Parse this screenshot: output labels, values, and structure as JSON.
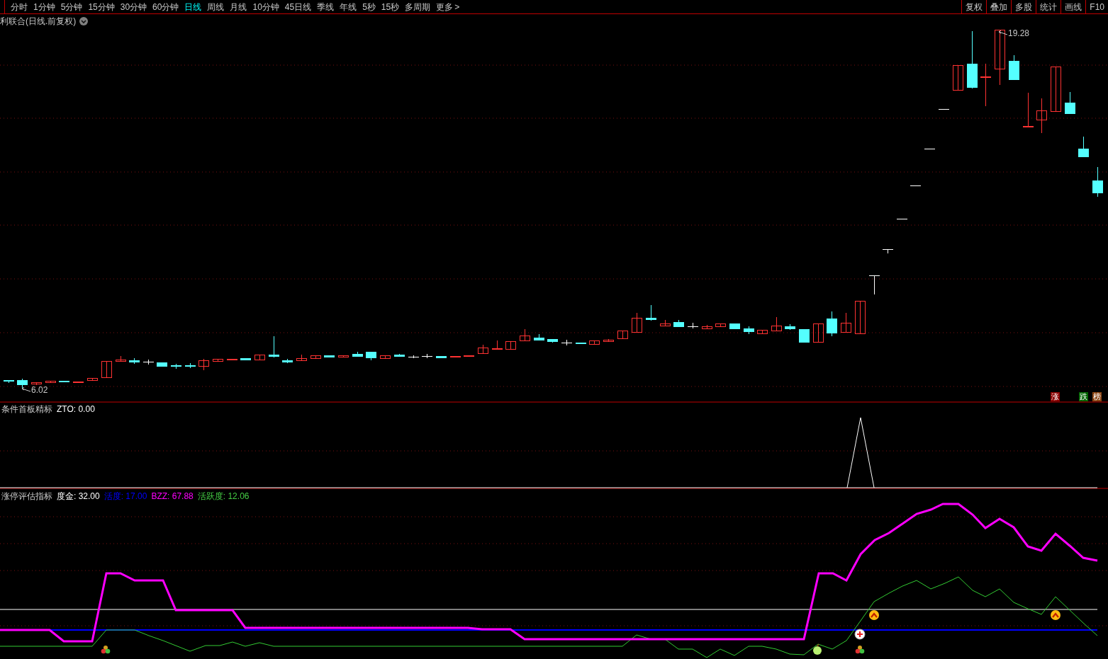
{
  "toolbar": {
    "periods": [
      {
        "label": "分时",
        "selected": false
      },
      {
        "label": "1分钟",
        "selected": false
      },
      {
        "label": "5分钟",
        "selected": false
      },
      {
        "label": "15分钟",
        "selected": false
      },
      {
        "label": "30分钟",
        "selected": false
      },
      {
        "label": "60分钟",
        "selected": false
      },
      {
        "label": "日线",
        "selected": true
      },
      {
        "label": "周线",
        "selected": false
      },
      {
        "label": "月线",
        "selected": false
      },
      {
        "label": "10分钟",
        "selected": false
      },
      {
        "label": "45日线",
        "selected": false
      },
      {
        "label": "季线",
        "selected": false
      },
      {
        "label": "年线",
        "selected": false
      },
      {
        "label": "5秒",
        "selected": false
      },
      {
        "label": "15秒",
        "selected": false
      },
      {
        "label": "多周期",
        "selected": false
      },
      {
        "label": "更多",
        "selected": false
      }
    ],
    "more_arrow": ">",
    "buttons": [
      "复权",
      "叠加",
      "多股",
      "统计",
      "画线",
      "F10"
    ]
  },
  "main_chart": {
    "title": "利联合(日线.前复权)",
    "high_label": "19.28",
    "low_label": "6.02",
    "badges": [
      {
        "text": "涨",
        "color": "#8b0000"
      },
      {
        "text": "跌",
        "color": "#006400"
      },
      {
        "text": "榜",
        "color": "#8b4513"
      }
    ]
  },
  "indicator_1": {
    "name": "条件首板精标",
    "values": [
      {
        "text": "ZTO: 0.00",
        "color": "#ffffff"
      }
    ]
  },
  "indicator_2": {
    "name": "涨停评估指标",
    "values": [
      {
        "text": "度金: 32.00",
        "color": "#ffffff"
      },
      {
        "text": "活度: 17.00",
        "color": "#0000ff"
      },
      {
        "text": "BZZ: 67.88",
        "color": "#ff00ff"
      },
      {
        "text": "活跃度: 12.06",
        "color": "#44cc44"
      }
    ]
  }
}
